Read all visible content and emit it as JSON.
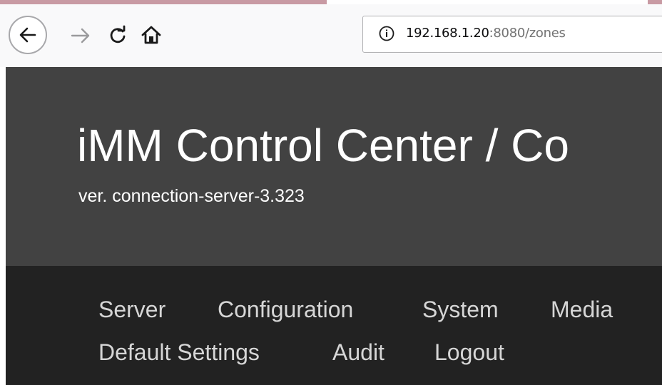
{
  "browser": {
    "url_host": "192.168.1.20",
    "url_rest": ":8080/zones",
    "icons": [
      "back-arrow-icon",
      "forward-arrow-icon",
      "reload-icon",
      "home-icon",
      "info-icon"
    ]
  },
  "header": {
    "title": "iMM Control Center / Co",
    "version": "ver. connection-server-3.323"
  },
  "nav": {
    "items": [
      "Server",
      "Configuration",
      "System",
      "Media",
      "Default Settings",
      "Audit",
      "Logout"
    ]
  },
  "colors": {
    "header_bg": "#424242",
    "nav_bg": "#222222",
    "nav_text": "#d6d6d6",
    "tab_accent": "#c89aa3"
  }
}
